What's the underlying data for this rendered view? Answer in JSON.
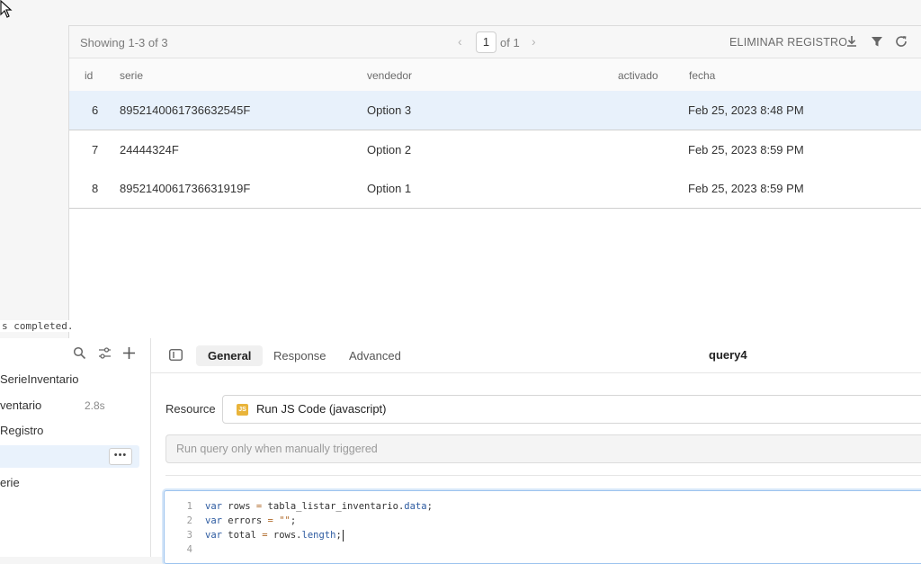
{
  "table": {
    "showing": "Showing 1-3 of 3",
    "prev": "‹",
    "page": "1",
    "of_text": "of 1",
    "next": "›",
    "delete_label": "ELIMINAR REGISTRO",
    "columns": [
      "id",
      "serie",
      "vendedor",
      "activado",
      "fecha"
    ],
    "rows": [
      {
        "id": "6",
        "serie": "8952140061736632545F",
        "vendedor": "Option 3",
        "activado": "",
        "fecha": "Feb 25, 2023 8:48 PM"
      },
      {
        "id": "7",
        "serie": "24444324F",
        "vendedor": "Option 2",
        "activado": "",
        "fecha": "Feb 25, 2023 8:59 PM"
      },
      {
        "id": "8",
        "serie": "8952140061736631919F",
        "vendedor": "Option 1",
        "activado": "",
        "fecha": "Feb 25, 2023 8:59 PM"
      }
    ],
    "selected_row": 0
  },
  "status": "s completed.",
  "queries": {
    "items": [
      {
        "label": "SerieInventario",
        "time": ""
      },
      {
        "label": "ventario",
        "time": "2.8s"
      },
      {
        "label": "Registro",
        "time": ""
      },
      {
        "label": "",
        "time": ""
      },
      {
        "label": "erie",
        "time": ""
      }
    ],
    "more_label": "•••"
  },
  "editor": {
    "tabs": [
      "General",
      "Response",
      "Advanced"
    ],
    "active_tab": "General",
    "query_name": "query4",
    "resource_label": "Resource",
    "resource_badge": "JS",
    "resource_value": "Run JS Code (javascript)",
    "trigger_text": "Run query only when manually triggered",
    "code_lines": [
      "1",
      "2",
      "3",
      "4"
    ]
  },
  "icons": {
    "toolbar": [
      "download-icon",
      "filter-icon",
      "refresh-icon"
    ],
    "query_panel": [
      "search-icon",
      "sliders-icon",
      "plus-icon"
    ]
  },
  "colors": {
    "accent": "#e8f1fb",
    "js_badge": "#e9b43a",
    "keyword": "#2c5aa0"
  }
}
